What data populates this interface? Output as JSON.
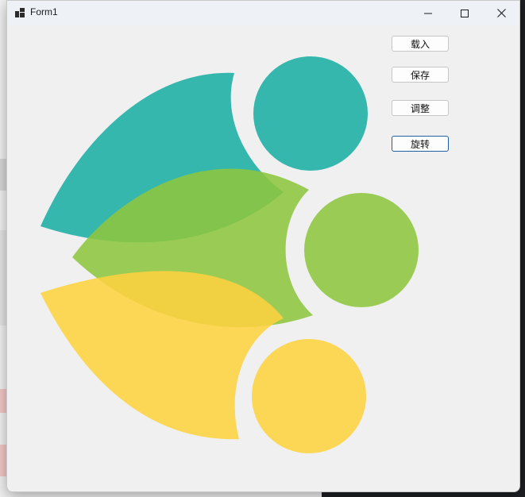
{
  "window": {
    "title": "Form1",
    "icon": "winforms-app-icon",
    "controls": {
      "minimize_icon": "minimize-icon",
      "maximize_icon": "maximize-icon",
      "close_icon": "close-icon"
    }
  },
  "buttons": {
    "load": "载入",
    "save": "保存",
    "adjust": "调整",
    "rotate": "旋转"
  },
  "colors": {
    "teal": "#1aaea4",
    "green": "#8dc63f",
    "yellow": "#fdd13f",
    "form_background": "#f0f0f0",
    "focus_border": "#1e5fa8"
  }
}
